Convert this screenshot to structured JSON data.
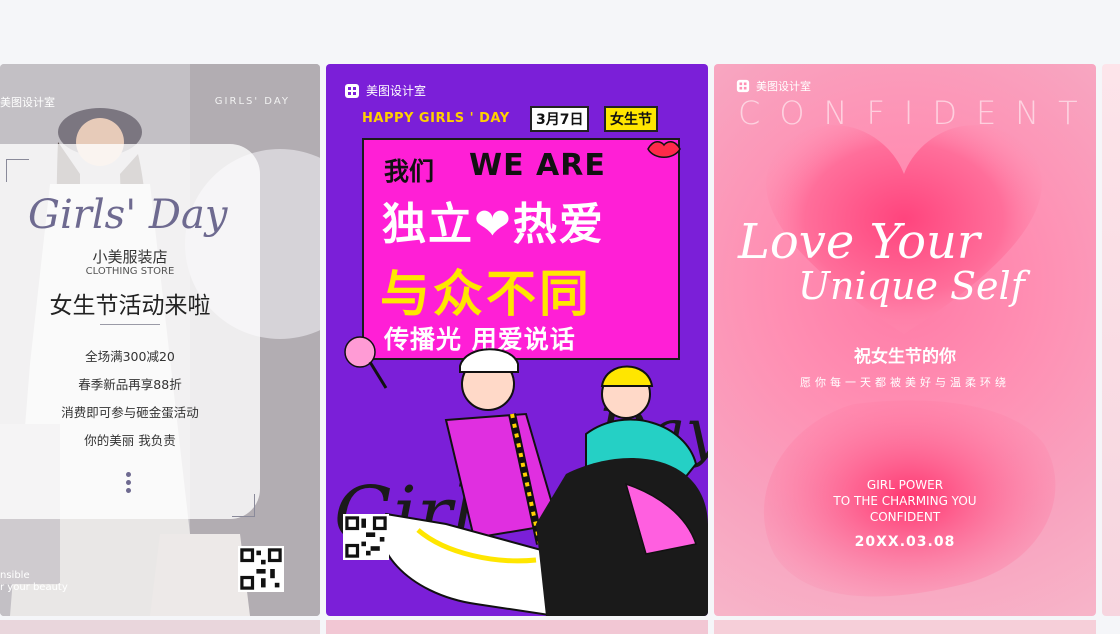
{
  "colors": {
    "page_bg": "#f5f6f9",
    "card2_bg": "#7b1fd8",
    "card2_box": "#ff1fd6",
    "card2_yellow": "#ffe600",
    "card3_pink": "#ff8fb3",
    "card1_script": "#6e6a90"
  },
  "cards": [
    {
      "brand": "美图设计室",
      "tag": "GIRLS' DAY",
      "script_title": "Girls' Day",
      "store": "小美服装店",
      "store_en": "CLOTHING STORE",
      "headline": "女生节活动来啦",
      "lines": [
        "全场满300减20",
        "春季新品再享88折",
        "消费即可参与砸金蛋活动",
        "你的美丽 我负责"
      ],
      "footer": [
        "nsible",
        "r your beauty"
      ],
      "icons": [
        "qr-code-icon",
        "more-dots-icon"
      ]
    },
    {
      "brand": "美图设计室",
      "happy": "HAPPY GIRLS ' DAY",
      "date": "3月7日",
      "festival": "女生节",
      "line1_cn": "我们",
      "line1_en": "WE ARE",
      "line2": "独立❤热爱",
      "line3": "与众不同",
      "line4": "传播光 用爱说话",
      "script": "Girls Day",
      "icons": [
        "brand-logo-icon",
        "qr-code-icon",
        "lips-icon",
        "fan-icon"
      ]
    },
    {
      "brand": "美图设计室",
      "confident": "CONFIDENT",
      "love_line1": "Love Your",
      "love_line2": "Unique Self",
      "cn_title": "祝女生节的你",
      "cn_sub": "愿你每一天都被美好与温柔环绕",
      "en_lines": [
        "GIRL POWER",
        "TO THE CHARMING YOU",
        "CONFIDENT"
      ],
      "date": "20XX.03.08",
      "icons": [
        "brand-logo-icon",
        "heart-shape-icon"
      ]
    }
  ]
}
